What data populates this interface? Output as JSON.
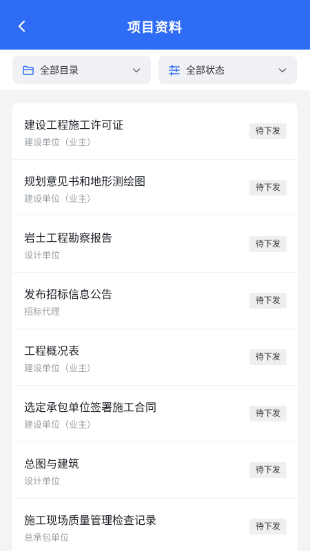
{
  "header": {
    "title": "项目资料"
  },
  "filters": {
    "catalog_label": "全部目录",
    "status_label": "全部状态"
  },
  "items": [
    {
      "title": "建设工程施工许可证",
      "org": "建设单位（业主）",
      "status": "待下发"
    },
    {
      "title": "规划意见书和地形测绘图",
      "org": "建设单位（业主）",
      "status": "待下发"
    },
    {
      "title": "岩土工程勘察报告",
      "org": "设计单位",
      "status": "待下发"
    },
    {
      "title": "发布招标信息公告",
      "org": "招标代理",
      "status": "待下发"
    },
    {
      "title": "工程概况表",
      "org": "建设单位（业主）",
      "status": "待下发"
    },
    {
      "title": "选定承包单位签署施工合同",
      "org": "建设单位（业主）",
      "status": "待下发"
    },
    {
      "title": "总图与建筑",
      "org": "设计单位",
      "status": "待下发"
    },
    {
      "title": "施工现场质量管理检查记录",
      "org": "总承包单位",
      "status": "待下发"
    }
  ],
  "colors": {
    "primary": "#2f6cf5",
    "background": "#f3f4f6"
  },
  "icons": {
    "back": "chevron-left-icon",
    "catalog": "folder-icon",
    "status": "sliders-icon",
    "dropdown": "chevron-down-icon"
  }
}
